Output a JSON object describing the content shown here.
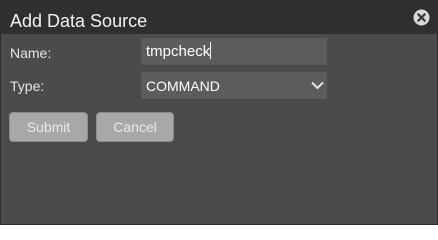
{
  "dialog": {
    "title": "Add Data Source",
    "close_icon": "close-circle-icon"
  },
  "form": {
    "name_label": "Name:",
    "name_value": "tmpcheck",
    "type_label": "Type:",
    "type_value": "COMMAND",
    "type_dropdown_icon": "chevron-down-icon"
  },
  "buttons": {
    "submit_label": "Submit",
    "cancel_label": "Cancel"
  },
  "colors": {
    "title_bar": "#2f2f2f",
    "dialog_body": "#4b4b4b",
    "field_background": "#5c5c5c",
    "button_background": "#a8a8a8"
  }
}
